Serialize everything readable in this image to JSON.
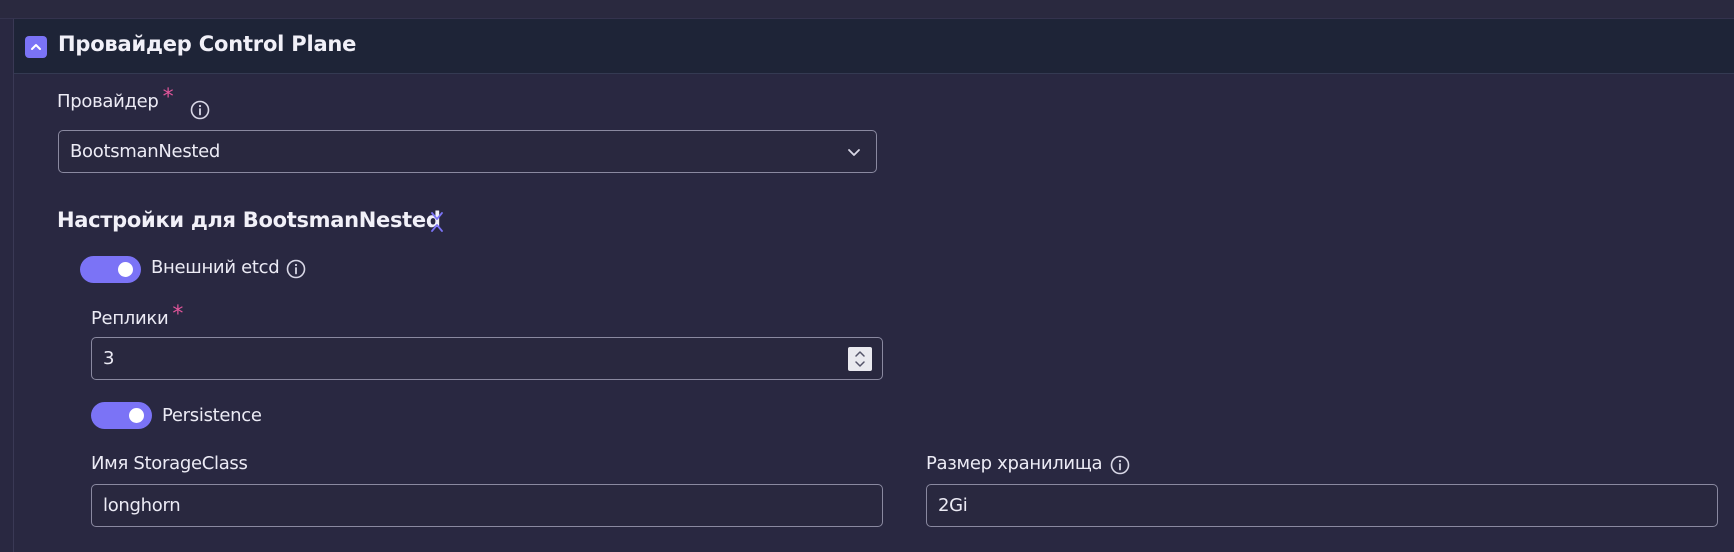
{
  "section": {
    "title": "Провайдер Control Plane",
    "expanded": true
  },
  "provider": {
    "label": "Провайдер",
    "required_mark": "*",
    "value": "BootsmanNested"
  },
  "settings": {
    "title": "Настройки для BootsmanNested",
    "external_etcd": {
      "label": "Внешний etcd",
      "enabled": true
    },
    "replicas": {
      "label": "Реплики",
      "required_mark": "*",
      "value": "3"
    },
    "persistence": {
      "label": "Persistence",
      "enabled": true
    },
    "storage_class": {
      "label": "Имя StorageClass",
      "value": "longhorn"
    },
    "storage_size": {
      "label": "Размер хранилища",
      "value": "2Gi"
    }
  },
  "colors": {
    "accent": "#7b73f6",
    "required": "#e0559a",
    "background": "#292841",
    "header_background": "#1e2437"
  },
  "icons": {
    "collapse": "chevron-up-icon",
    "info": "info-icon",
    "select": "chevron-down-icon",
    "expand": "expand-collapse-icon",
    "stepper": "stepper-icon"
  }
}
